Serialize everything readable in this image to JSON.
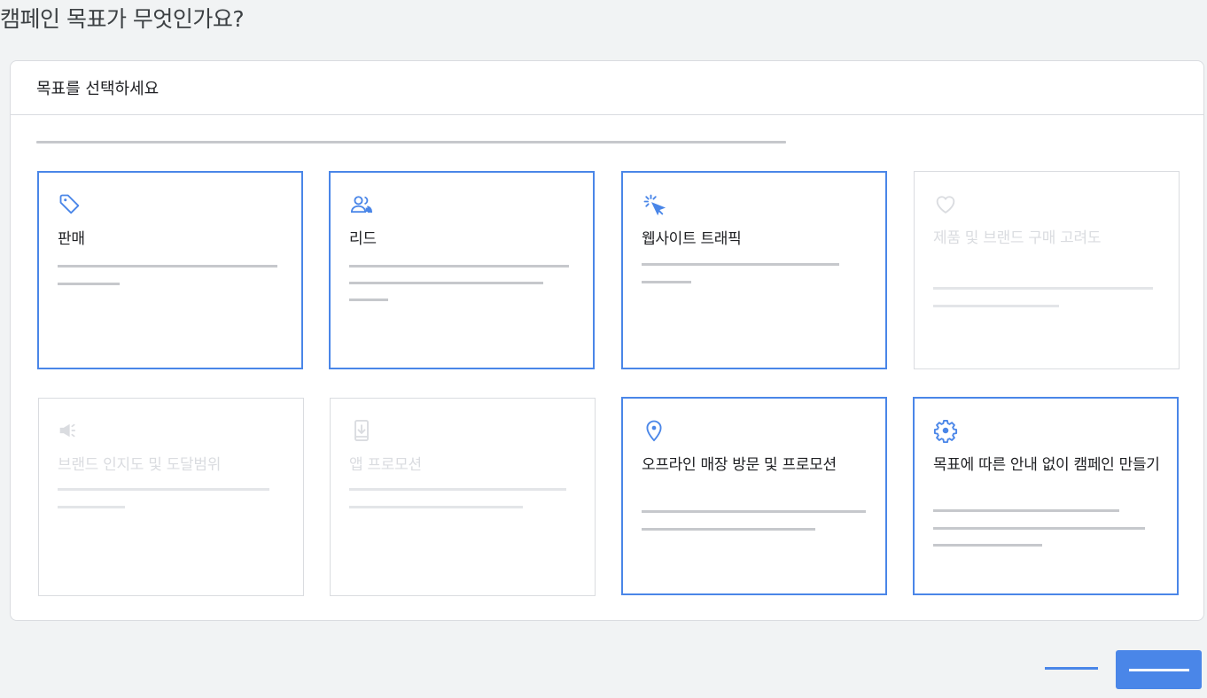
{
  "page": {
    "title": "캠페인 목표가 무엇인가요?"
  },
  "panel": {
    "header": "목표를 선택하세요"
  },
  "colors": {
    "accent": "#4a86e8",
    "disabled_text": "#dadce0",
    "skeleton": "#c6c8cc"
  },
  "goals": [
    {
      "label": "판매",
      "icon": "tag-icon",
      "enabled": true
    },
    {
      "label": "리드",
      "icon": "people-icon",
      "enabled": true
    },
    {
      "label": "웹사이트 트래픽",
      "icon": "cursor-click-icon",
      "enabled": true
    },
    {
      "label": "제품 및 브랜드 구매 고려도",
      "icon": "heart-icon",
      "enabled": false
    },
    {
      "label": "브랜드 인지도 및 도달범위",
      "icon": "megaphone-icon",
      "enabled": false
    },
    {
      "label": "앱 프로모션",
      "icon": "phone-download-icon",
      "enabled": false
    },
    {
      "label": "오프라인 매장 방문 및 프로모션",
      "icon": "location-pin-icon",
      "enabled": true
    },
    {
      "label": "목표에 따른 안내 없이 캠페인 만들기",
      "icon": "gear-icon",
      "enabled": true
    }
  ]
}
